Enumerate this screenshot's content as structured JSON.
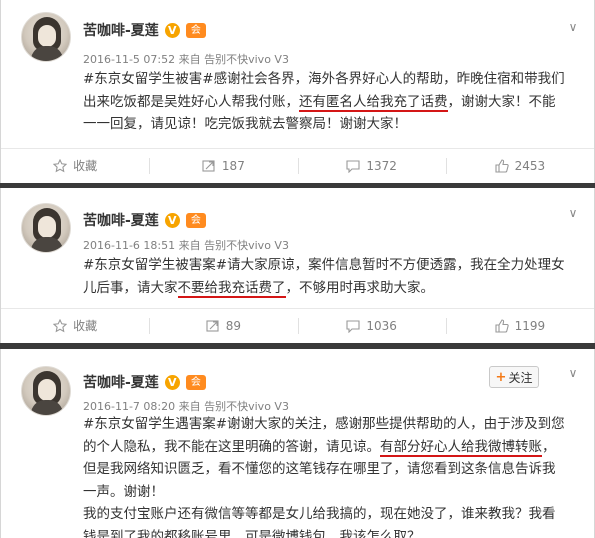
{
  "posts": [
    {
      "author": "苦咖啡-夏莲",
      "verified_badge": "V",
      "member_badge": "会",
      "meta": "2016-11-5 07:52 来自 告别不快vivo V3",
      "lines": [
        [
          "#东京女留学生被害#感谢社会各界，海外各界好心人的帮助，昨晚住宿和带我们"
        ],
        [
          "出来吃饭都是吴姓好心人帮我付账，",
          {
            "u": "还有匿名人给我充了话费"
          },
          "，谢谢大家！不能"
        ],
        [
          "一一回复，请见谅！吃完饭我就去警察局！谢谢大家！"
        ]
      ],
      "actions": {
        "collect": "收藏",
        "forward": "187",
        "comment": "1372",
        "like": "2453"
      }
    },
    {
      "author": "苦咖啡-夏莲",
      "verified_badge": "V",
      "member_badge": "会",
      "meta": "2016-11-6 18:51 来自 告别不快vivo V3",
      "lines": [
        [
          "#东京女留学生被害案#请大家原谅，案件信息暂时不方便透露，我在全力处理女"
        ],
        [
          "儿后事，请大家",
          {
            "u": "不要给我充话费了"
          },
          "，不够用时再求助大家。"
        ]
      ],
      "actions": {
        "collect": "收藏",
        "forward": "89",
        "comment": "1036",
        "like": "1199"
      }
    },
    {
      "author": "苦咖啡-夏莲",
      "verified_badge": "V",
      "member_badge": "会",
      "follow": "关注",
      "meta": "2016-11-7 08:20 来自 告别不快vivo V3",
      "lines": [
        [
          "#东京女留学生遇害案#谢谢大家的关注，感谢那些提供帮助的人，由于涉及到您"
        ],
        [
          "的个人隐私，我不能在这里明确的答谢，请见谅。",
          {
            "u": "有部分好心人给我微博转账"
          },
          "，"
        ],
        [
          "但是我网络知识匮乏，看不懂您的这笔钱存在哪里了，请您看到这条信息告诉我"
        ],
        [
          "一声。谢谢！"
        ],
        [
          "我的支付宝账户还有微信等等都是女儿给我搞的，现在她没了，谁来教我？我看"
        ],
        [
          "钱是到了我的都移账号里，可是微博钱包，我该怎么取？"
        ]
      ]
    }
  ]
}
